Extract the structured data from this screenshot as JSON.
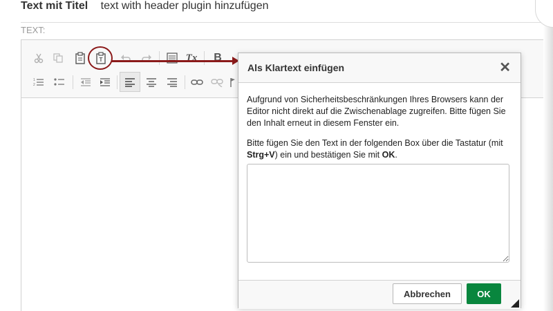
{
  "header": {
    "title": "Text mit Titel",
    "subtitle": "text with header plugin hinzufügen"
  },
  "field": {
    "label": "TEXT:"
  },
  "toolbar": {
    "bold_label": "B",
    "remove_format_label": "Tx",
    "paste_text_label": "T",
    "icons": [
      "cut-icon",
      "copy-icon",
      "paste-icon",
      "paste-as-text-icon",
      "undo-icon",
      "redo-icon",
      "source-icon",
      "remove-format-icon",
      "bold-icon",
      "numbered-list-icon",
      "bulleted-list-icon",
      "outdent-icon",
      "indent-icon",
      "align-left-icon",
      "align-center-icon",
      "align-right-icon",
      "link-icon",
      "unlink-icon",
      "anchor-icon"
    ]
  },
  "dialog": {
    "title": "Als Klartext einfügen",
    "close_label": "✕",
    "paragraph1": "Aufgrund von Sicherheitsbeschränkungen Ihres Browsers kann der Editor nicht direkt auf die Zwischenablage zugreifen. Bitte fügen Sie den Inhalt erneut in diesem Fenster ein.",
    "paragraph2_before": "Bitte fügen Sie den Text in der folgenden Box über die Tastatur (mit ",
    "paragraph2_shortcut": "Strg+V",
    "paragraph2_middle": ") ein und bestätigen Sie mit ",
    "paragraph2_ok": "OK",
    "paragraph2_end": ".",
    "paste_area_value": "",
    "cancel_label": "Abbrechen",
    "ok_label": "OK"
  },
  "colors": {
    "highlight": "#8b1a1a",
    "ok_button": "#09863e"
  }
}
